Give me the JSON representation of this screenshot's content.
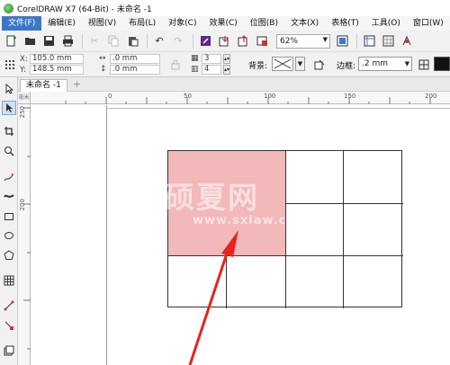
{
  "window": {
    "title": "CorelDRAW X7 (64-Bit) - 未命名 -1"
  },
  "menu": [
    "文件(F)",
    "编辑(E)",
    "视图(V)",
    "布局(L)",
    "对象(C)",
    "效果(C)",
    "位图(B)",
    "文本(X)",
    "表格(T)",
    "工具(O)",
    "窗口(W)",
    "帮"
  ],
  "toolbar": {
    "zoom": "62%"
  },
  "propbar": {
    "x_label": "X:",
    "x_value": "105.0 mm",
    "y_label": "Y:",
    "y_value": "148.5 mm",
    "w_value": ".0 mm",
    "h_value": ".0 mm",
    "rows": "3",
    "cols": "4",
    "bg_label": "背景:",
    "border_label": "边框:",
    "border_value": ".2 mm"
  },
  "document": {
    "tab": "未命名 -1",
    "add_tab": "+"
  },
  "ruler": {
    "h_labels": [
      "0",
      "50",
      "100",
      "150",
      "200"
    ],
    "v_labels": [
      "250",
      "200"
    ],
    "unit": "毫米"
  },
  "watermark": {
    "text": "硕夏网",
    "url": "www.sxiaw.com"
  },
  "colors": {
    "merged_cell": "#f2b8ba",
    "menu_active": "#3c78c8",
    "arrow": "#e8231e"
  }
}
